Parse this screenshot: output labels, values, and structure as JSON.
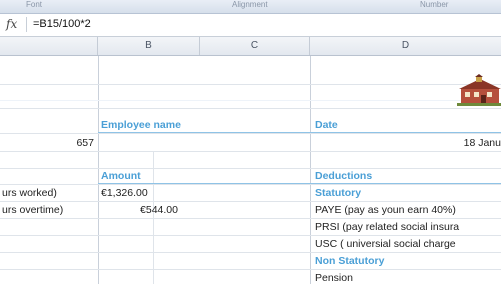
{
  "ribbon": {
    "labels": [
      "Font",
      "Alignment",
      "Number"
    ]
  },
  "formula_bar": {
    "fx_label": "fx",
    "formula": "=B15/100*2"
  },
  "columns": [
    "B",
    "C",
    "D"
  ],
  "cells": {
    "employee_name_header": "Employee name",
    "date_header": "Date",
    "number_value": "657",
    "date_value": "18 Janu",
    "amount_header": "Amount",
    "deductions_header": "Deductions",
    "hours_worked_label": "urs worked)",
    "hours_worked_amount": "€1,326.00",
    "statutory_label": "Statutory",
    "hours_overtime_label": "urs overtime)",
    "hours_overtime_amount": "€544.00",
    "paye_label": "PAYE (pay as youn earn 40%)",
    "prsi_label": "PRSI (pay related social insura",
    "usc_label": "USC ( universial social charge",
    "non_statutory_label": "Non Statutory",
    "pension_label": "Pension"
  },
  "colors": {
    "accent": "#4a9fd6",
    "grid": "#dfe4ea"
  },
  "icons": {
    "logo": "schoolhouse-logo-icon"
  }
}
